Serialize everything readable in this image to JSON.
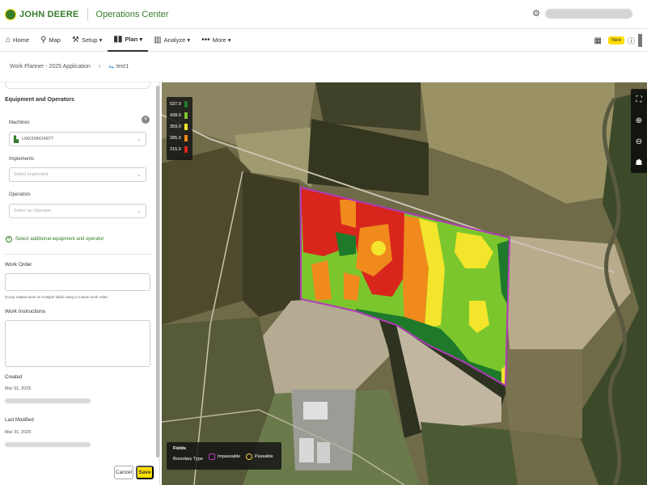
{
  "header": {
    "brand": "JOHN DEERE",
    "app_name": "Operations Center"
  },
  "nav": {
    "items": [
      {
        "label": "Home",
        "icon": "home-icon",
        "glyph": "⌂"
      },
      {
        "label": "Map",
        "icon": "person-pin-icon",
        "glyph": "⚲"
      },
      {
        "label": "Setup ▾",
        "icon": "setup-icon",
        "glyph": "⚒"
      },
      {
        "label": "Plan ▾",
        "icon": "plan-icon",
        "glyph": "▮▮"
      },
      {
        "label": "Analyze ▾",
        "icon": "analyze-icon",
        "glyph": "▥"
      },
      {
        "label": "More ▾",
        "icon": "more-icon",
        "glyph": "•••"
      }
    ],
    "badge": "New"
  },
  "breadcrumb": {
    "parent": "Work Planner - 2025 Application",
    "current": "test1"
  },
  "panel": {
    "equipment_title": "Equipment and Operators",
    "machines_label": "Machines",
    "machine_value": "LMX208424877",
    "implements_label": "Implements",
    "implements_placeholder": "Select Implement",
    "operators_label": "Operators",
    "operators_placeholder": "Select an Operator",
    "add_link": "Select additional equipment and operator",
    "work_order_label": "Work Order",
    "work_order_help": "Group related work on multiple fields using a custom work order.",
    "work_instructions_label": "Work Instructions",
    "created_label": "Created",
    "created_date": "Mar 31, 2025",
    "last_modified_label": "Last Modified",
    "last_modified_date": "Mar 31, 2025",
    "cancel_label": "Cancel",
    "save_label": "Save"
  },
  "map": {
    "legend": [
      {
        "value": "537.0",
        "color": "#1e7a2a"
      },
      {
        "value": "438.0",
        "color": "#7bc62d"
      },
      {
        "value": "359.0",
        "color": "#f2e52b"
      },
      {
        "value": "285.0",
        "color": "#f08a1c"
      },
      {
        "value": "215.0",
        "color": "#d8261c"
      }
    ],
    "fields_title": "Fields",
    "boundary_type_label": "Boundary Type",
    "impassable_label": "Impassable",
    "passable_label": "Passable",
    "impassable_color": "#b03ab8",
    "passable_color": "#e8d33a"
  },
  "colors": {
    "brand_green": "#367c2b",
    "brand_yellow": "#ffde00"
  }
}
